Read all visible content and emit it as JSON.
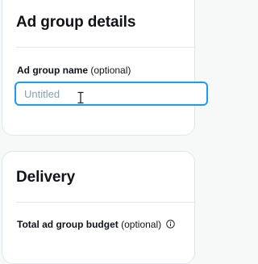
{
  "ad_group_details": {
    "title": "Ad group details",
    "name_field": {
      "label": "Ad group name",
      "label_suffix": "(optional)",
      "placeholder": "Untitled",
      "value": ""
    }
  },
  "delivery": {
    "title": "Delivery",
    "budget_field": {
      "label": "Total ad group budget",
      "label_suffix": "(optional)",
      "icon": "info-icon"
    }
  },
  "colors": {
    "focus_border": "#1d9bf0",
    "card_border": "#e1e8ed",
    "page_background": "#f7f9f9"
  },
  "cursor": "text-cursor-icon"
}
